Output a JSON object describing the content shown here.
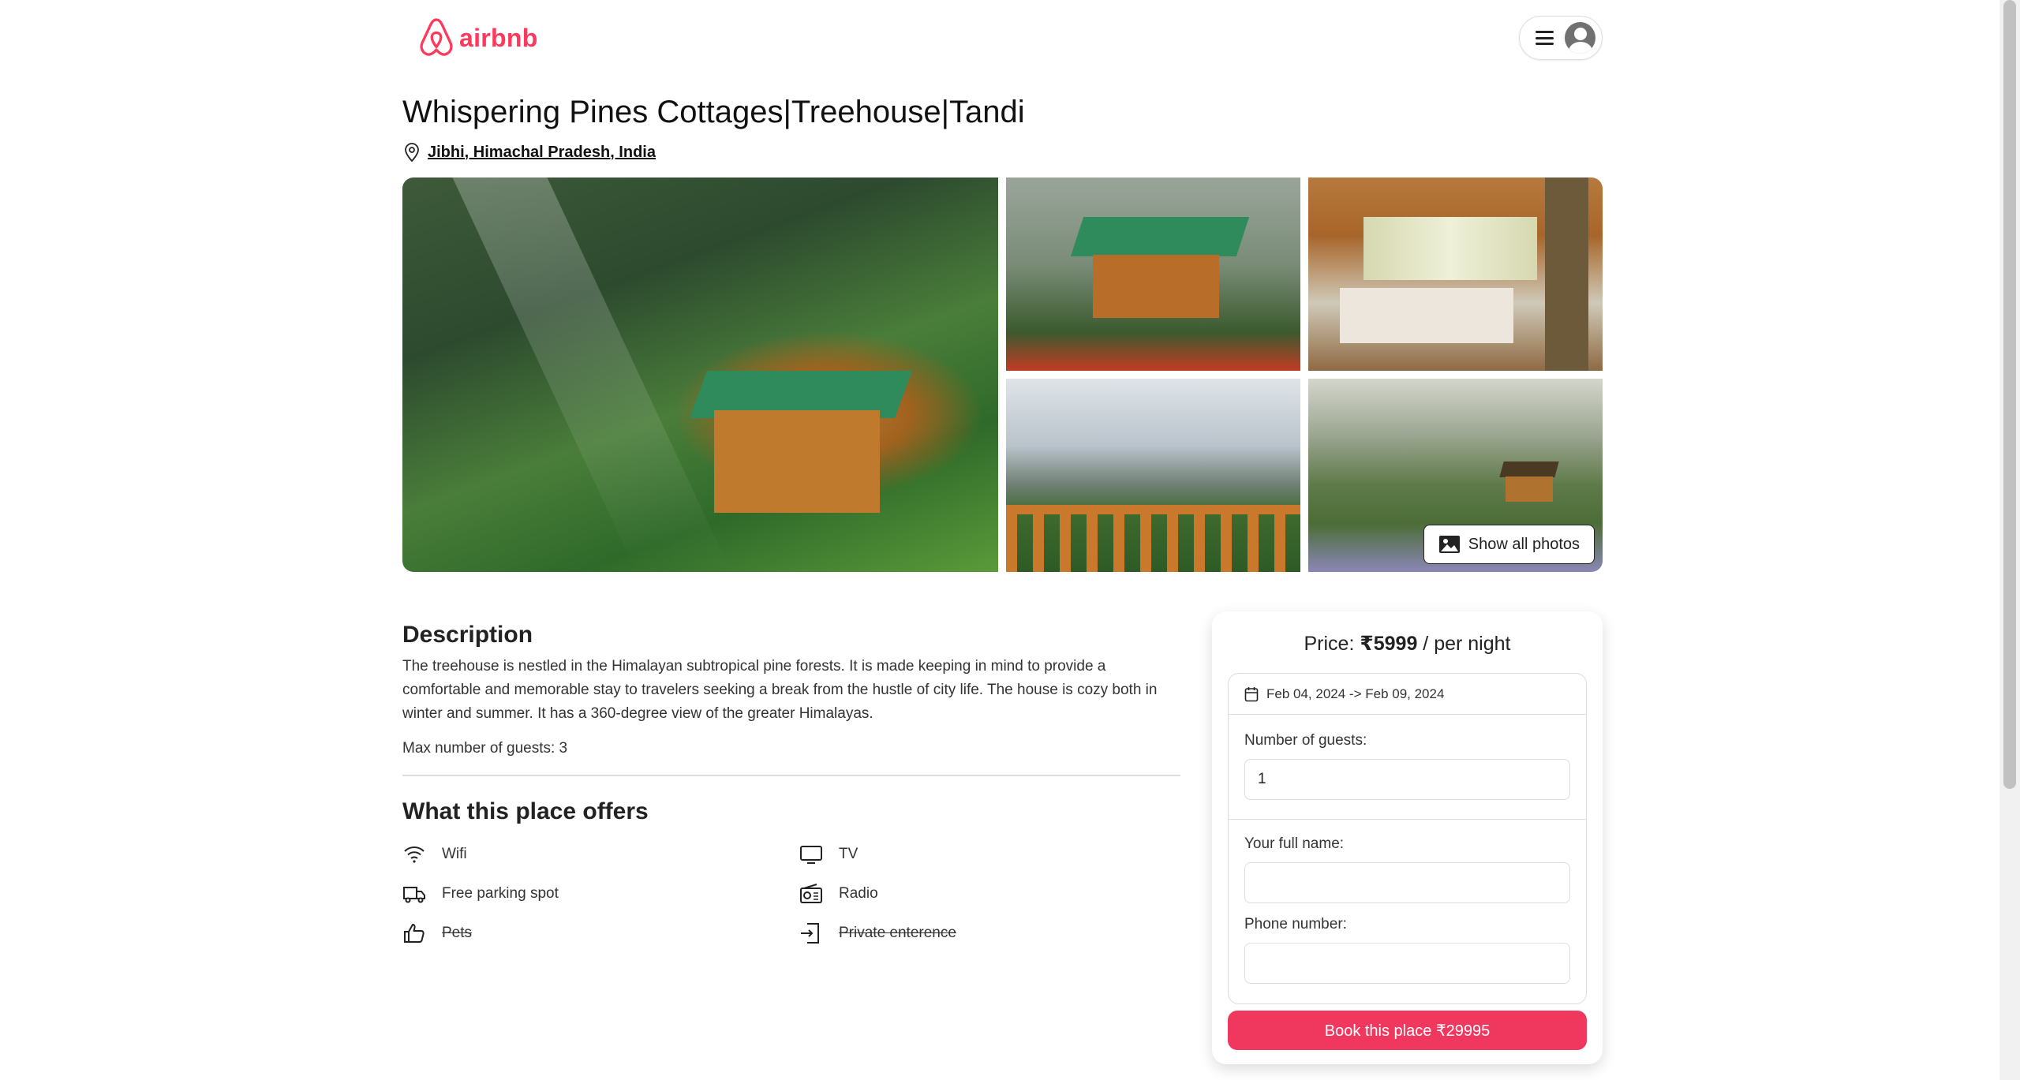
{
  "header": {
    "logo_text": "airbnb",
    "brand_color": "#ff385c",
    "menu_icon": "hamburger-icon",
    "avatar_icon": "user-avatar-icon"
  },
  "listing": {
    "title": "Whispering Pines Cottages|Treehouse|Tandi",
    "location": "Jibhi, Himachal Pradesh, India",
    "show_all_photos": "Show all photos"
  },
  "description": {
    "heading": "Description",
    "text": "The treehouse is nestled in the Himalayan subtropical pine forests. It is made keeping in mind to provide a comfortable and memorable stay to travelers seeking a break from the hustle of city life. The house is cozy both in winter and summer. It has a 360-degree view of the greater Himalayas.",
    "max_guests": "Max number of guests: 3"
  },
  "offers": {
    "heading": "What this place offers",
    "items": [
      {
        "label": "Wifi",
        "icon": "wifi-icon",
        "available": true
      },
      {
        "label": "TV",
        "icon": "tv-icon",
        "available": true
      },
      {
        "label": "Free parking spot",
        "icon": "truck-icon",
        "available": true
      },
      {
        "label": "Radio",
        "icon": "radio-icon",
        "available": true
      },
      {
        "label": "Pets",
        "icon": "thumbs-up-icon",
        "available": false
      },
      {
        "label": "Private enterence",
        "icon": "door-enter-icon",
        "available": false
      }
    ]
  },
  "booking": {
    "price_prefix": "Price: ",
    "price_value": "₹5999",
    "price_suffix": " / per night",
    "dates": "Feb 04, 2024 -> Feb 09, 2024",
    "guests_label": "Number of guests:",
    "guests_value": "1",
    "name_label": "Your full name:",
    "name_value": "",
    "phone_label": "Phone number:",
    "phone_value": "",
    "button_label": "Book this place ₹29995",
    "button_color": "#f0375d"
  }
}
